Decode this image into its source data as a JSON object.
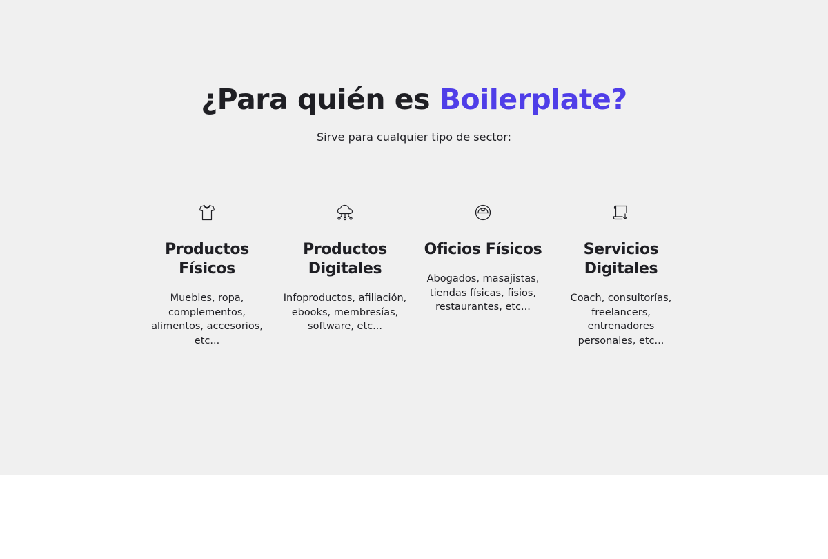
{
  "section": {
    "title_prefix": "¿Para quién es ",
    "title_highlight": "Boilerplate?",
    "subtitle": "Sirve para cualquier tipo de sector:",
    "accent_color": "#4f3ee8",
    "background_color": "#f0f0f0"
  },
  "cards": [
    {
      "icon": "t-shirt-icon",
      "title_line1": "Productos",
      "title_line2": "Físicos",
      "text": "Muebles, ropa, complementos, alimentos, accesorios, etc..."
    },
    {
      "icon": "cloud-network-icon",
      "title_line1": "Productos",
      "title_line2": "Digitales",
      "text": "Infoproductos, afiliación, ebooks, membresías, software, etc..."
    },
    {
      "icon": "hard-hat-icon",
      "title_line1": "Oficios Físicos",
      "title_line2": "",
      "text": "Abogados, masajistas, tiendas físicas, fisios, restaurantes, etc..."
    },
    {
      "icon": "scroll-download-icon",
      "title_line1": "Servicios",
      "title_line2": "Digitales",
      "text": "Coach, consultorías, freelancers, entrenadores personales, etc..."
    }
  ]
}
